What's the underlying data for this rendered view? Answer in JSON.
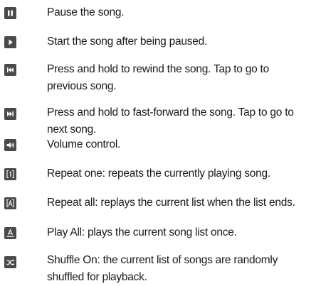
{
  "legend": {
    "items": [
      {
        "icon": "pause-icon",
        "text": "Pause the song."
      },
      {
        "icon": "play-icon",
        "text": "Start the song after being paused."
      },
      {
        "icon": "rewind-previous-icon",
        "text": "Press and hold to rewind the song. Tap to go to previous song."
      },
      {
        "icon": "fast-forward-next-icon",
        "text": "Press and hold to fast-forward  the song. Tap to go to next song."
      },
      {
        "icon": "volume-icon",
        "text": "Volume control."
      },
      {
        "icon": "repeat-one-icon",
        "text": "Repeat one: repeats the currently playing song."
      },
      {
        "icon": "repeat-all-icon",
        "text": "Repeat all: replays the current list when the list ends."
      },
      {
        "icon": "play-all-icon",
        "text": "Play All: plays the current song list once."
      },
      {
        "icon": "shuffle-icon",
        "text": "Shuffle On: the current list of songs are randomly shuffled for playback."
      }
    ]
  }
}
